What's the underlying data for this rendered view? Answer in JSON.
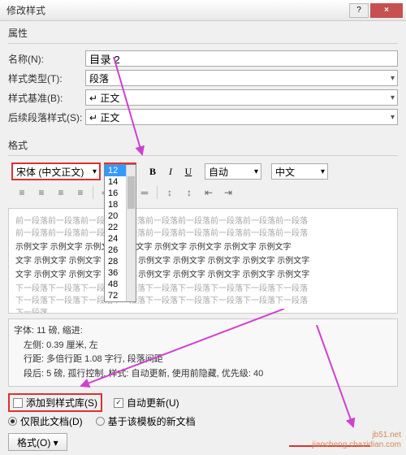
{
  "titlebar": {
    "title": "修改样式"
  },
  "sections": {
    "properties": "属性",
    "format": "格式"
  },
  "fields": {
    "name_label": "名称(N):",
    "name_value": "目录 2",
    "type_label": "样式类型(T):",
    "type_value": "段落",
    "base_label": "样式基准(B):",
    "base_value": "↵ 正文",
    "next_label": "后续段落样式(S):",
    "next_value": "↵ 正文"
  },
  "toolbar": {
    "font": "宋体 (中文正文)",
    "size": "12",
    "size_options": [
      "12",
      "14",
      "16",
      "18",
      "20",
      "22",
      "24",
      "26",
      "28",
      "36",
      "48",
      "72"
    ],
    "auto1": "自动",
    "lang": "中文"
  },
  "preview": {
    "grey1": "前一段落前一段落前一段落前一段落前一段落前一段落前一段落前一段落前一段落",
    "dark1": "示例文字 示例文字 示例文字 示例文字 示例文字 示例文字 示例文字 示例文字",
    "dark2": "文字 示例文字 示例文字 示例文字 示例文字 示例文字 示例文字 示例文字 示例文字",
    "grey2": "下一段落下一段落下一段落下一段落下一段落下一段落下一段落下一段落下一段落",
    "grey3": "下一段落"
  },
  "desc": {
    "l1": "字体: 11 磅, 缩进:",
    "l2": "左侧: 0.39 厘米, 左",
    "l3": "行距: 多倍行距 1.08 字行, 段落间距",
    "l4": "段后: 5 磅, 孤行控制, 样式: 自动更新, 使用前隐藏, 优先级: 40"
  },
  "checks": {
    "add": "添加到样式库(S)",
    "auto": "自动更新(U)",
    "only": "仅限此文档(D)",
    "tmpl": "基于该模板的新文档"
  },
  "footer": {
    "format": "格式(O) ▾"
  },
  "watermark": {
    "l1": "jb51.net",
    "l2": "jiaocheng.chazidian.com"
  }
}
